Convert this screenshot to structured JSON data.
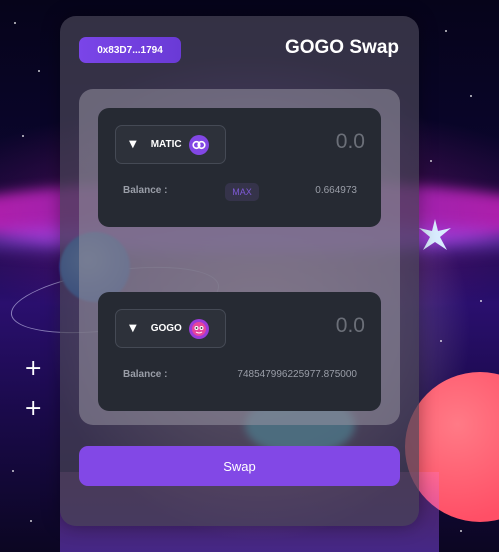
{
  "header": {
    "wallet_address": "0x83D7...1794",
    "title": "GOGO Swap"
  },
  "from_token": {
    "symbol": "MATIC",
    "icon": "matic-token-icon",
    "amount_placeholder": "0.0",
    "balance_label": "Balance :",
    "max_label": "MAX",
    "balance": "0.664973"
  },
  "switch": {
    "icon": "switch-direction-icon"
  },
  "to_token": {
    "symbol": "GOGO",
    "icon": "gogo-token-icon",
    "amount_placeholder": "0.0",
    "balance_label": "Balance :",
    "balance": "748547996225977.875000"
  },
  "actions": {
    "swap_label": "Swap"
  },
  "colors": {
    "accent": "#8248e6",
    "panel": "#262a33",
    "muted_text": "#9a9ea8"
  }
}
